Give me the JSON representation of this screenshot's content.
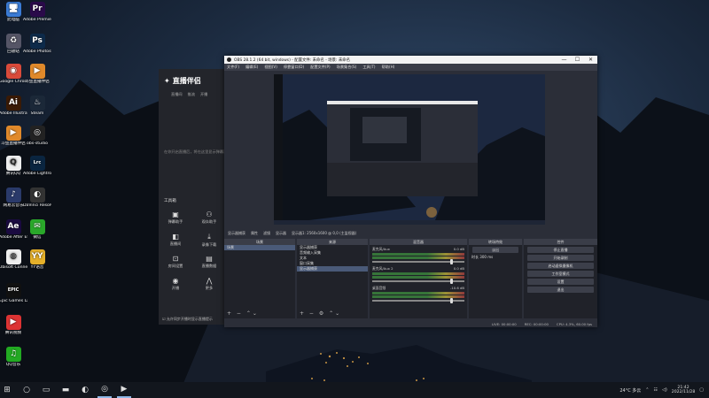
{
  "desktop": {
    "icons": [
      {
        "label": "此电脑",
        "icon": "computer-icon",
        "glyph": "🖥",
        "color": "#3a7bd5"
      },
      {
        "label": "Adobe Premie...",
        "icon": "premiere-icon",
        "glyph": "Pr",
        "color": "#2a0a4a"
      },
      {
        "label": "回收站",
        "icon": "recycle-bin-icon",
        "glyph": "♻",
        "color": "#556"
      },
      {
        "label": "Adobe Photosh...",
        "icon": "photoshop-icon",
        "glyph": "Ps",
        "color": "#0d2a4a"
      },
      {
        "label": "Google Chrome",
        "icon": "chrome-icon",
        "glyph": "◉",
        "color": "#d94a3a"
      },
      {
        "label": "斗鱼直播伴侣",
        "icon": "app-icon",
        "glyph": "▶",
        "color": "#e0892a"
      },
      {
        "label": "Adobe Illustrat...",
        "icon": "illustrator-icon",
        "glyph": "Ai",
        "color": "#3a1a05"
      },
      {
        "label": "Steam",
        "icon": "steam-icon",
        "glyph": "♨",
        "color": "#1b2838"
      },
      {
        "label": "斗鱼直播伴侣",
        "icon": "app-icon",
        "glyph": "▶",
        "color": "#e0892a"
      },
      {
        "label": "obs-studio",
        "icon": "obs-icon",
        "glyph": "◎",
        "color": "#222"
      },
      {
        "label": "腾讯QQ",
        "icon": "qq-icon",
        "glyph": "Q",
        "color": "#eee"
      },
      {
        "label": "Adobe Lightroo...",
        "icon": "lightroom-icon",
        "glyph": "Lrc",
        "color": "#0a2540"
      },
      {
        "label": "网易云音乐",
        "icon": "music-icon",
        "glyph": "♪",
        "color": "#2a3a6a"
      },
      {
        "label": "DaVinci Resolve",
        "icon": "davinci-icon",
        "glyph": "◐",
        "color": "#333"
      },
      {
        "label": "Adobe After Effects CC",
        "icon": "aftereffects-icon",
        "glyph": "Ae",
        "color": "#1a0a40"
      },
      {
        "label": "微信",
        "icon": "wechat-icon",
        "glyph": "✉",
        "color": "#2aa82a"
      },
      {
        "label": "Ubisoft Connect",
        "icon": "ubisoft-icon",
        "glyph": "◍",
        "color": "#eee"
      },
      {
        "label": "YY语音",
        "icon": "yy-icon",
        "glyph": "YY",
        "color": "#e5b02a"
      },
      {
        "label": "Epic Games Launcher",
        "icon": "epic-icon",
        "glyph": "EPIC",
        "color": "#111"
      },
      {
        "label": "腾讯视频",
        "icon": "video-icon",
        "glyph": "▶",
        "color": "#d33"
      },
      {
        "label": "QQ音乐",
        "icon": "qqmusic-icon",
        "glyph": "♫",
        "color": "#2a2"
      }
    ]
  },
  "obs": {
    "title": "OBS 28.1.2 (64 bit, windows) - 配置文件: 未命名 - 场景: 未命名",
    "window_controls": [
      "—",
      "☐",
      "✕"
    ],
    "menu": [
      "文件(F)",
      "编辑(E)",
      "视图(V)",
      "停靠窗口(D)",
      "配置文件(P)",
      "场景集合(S)",
      "工具(T)",
      "帮助(H)"
    ],
    "control_bar": [
      "显示器捕获",
      "属性",
      "滤镜",
      "显示器",
      "显示器1: 2560x1600 @ 0,0 (主监视器)"
    ],
    "scenes": {
      "header": "场景",
      "items": [
        "场景"
      ]
    },
    "sources": {
      "header": "来源",
      "items": [
        "显示器捕获",
        "音频输入采集",
        "文本",
        "窗口采集",
        "显示器捕获"
      ]
    },
    "mixer": {
      "header": "混音器",
      "channels": [
        {
          "name": "麦克风/Aux",
          "db": "0.0 dB"
        },
        {
          "name": "麦克风/Aux 2",
          "db": "0.0 dB"
        },
        {
          "name": "桌面音频",
          "db": "-10.6 dB"
        }
      ]
    },
    "transitions": {
      "header": "转场特效",
      "type": "淡出",
      "duration_label": "时长",
      "duration": "300 ms"
    },
    "controls": {
      "header": "控件",
      "buttons": [
        "停止直播",
        "开始录制",
        "启动虚拟摄像机",
        "工作室模式",
        "设置",
        "退出"
      ]
    },
    "status": {
      "live": "LIVE: 00:00:00",
      "rec": "REC: 00:00:00",
      "cpu": "CPU: 4.3%, 60.00 fps"
    }
  },
  "live_app": {
    "brand": "直播伴侣",
    "nav": [
      "直播间",
      "推流",
      "开播"
    ],
    "message": "在你开启直播后，将在这里显示弹幕消息",
    "tools_title": "工具箱",
    "tools": [
      {
        "label": "弹幕助手",
        "icon": "danmaku-icon",
        "glyph": "▣"
      },
      {
        "label": "观众助手",
        "icon": "audience-icon",
        "glyph": "⚇"
      },
      {
        "label": "直播间",
        "icon": "room-icon",
        "glyph": "◧"
      },
      {
        "label": "录像下载",
        "icon": "download-icon",
        "glyph": "⤓"
      },
      {
        "label": "房间设置",
        "icon": "settings-icon",
        "glyph": "⊡"
      },
      {
        "label": "直播数据",
        "icon": "data-icon",
        "glyph": "▤"
      },
      {
        "label": "开播",
        "icon": "broadcast-icon",
        "glyph": "◉"
      },
      {
        "label": "更多",
        "icon": "more-icon",
        "glyph": "⋀"
      }
    ],
    "footer": "☑ 允许同步开播时显示直播提示"
  },
  "taskbar": {
    "apps": [
      {
        "icon": "windows-start-icon",
        "glyph": "⊞"
      },
      {
        "icon": "search-icon",
        "glyph": "○"
      },
      {
        "icon": "task-view-icon",
        "glyph": "▭"
      },
      {
        "icon": "file-explorer-icon",
        "glyph": "▬"
      },
      {
        "icon": "edge-icon",
        "glyph": "◐"
      },
      {
        "icon": "obs-icon",
        "glyph": "◎"
      },
      {
        "icon": "live-app-icon",
        "glyph": "▶"
      }
    ],
    "weather": "24°C 多云",
    "time": "21:42",
    "date": "2022/11/28"
  }
}
